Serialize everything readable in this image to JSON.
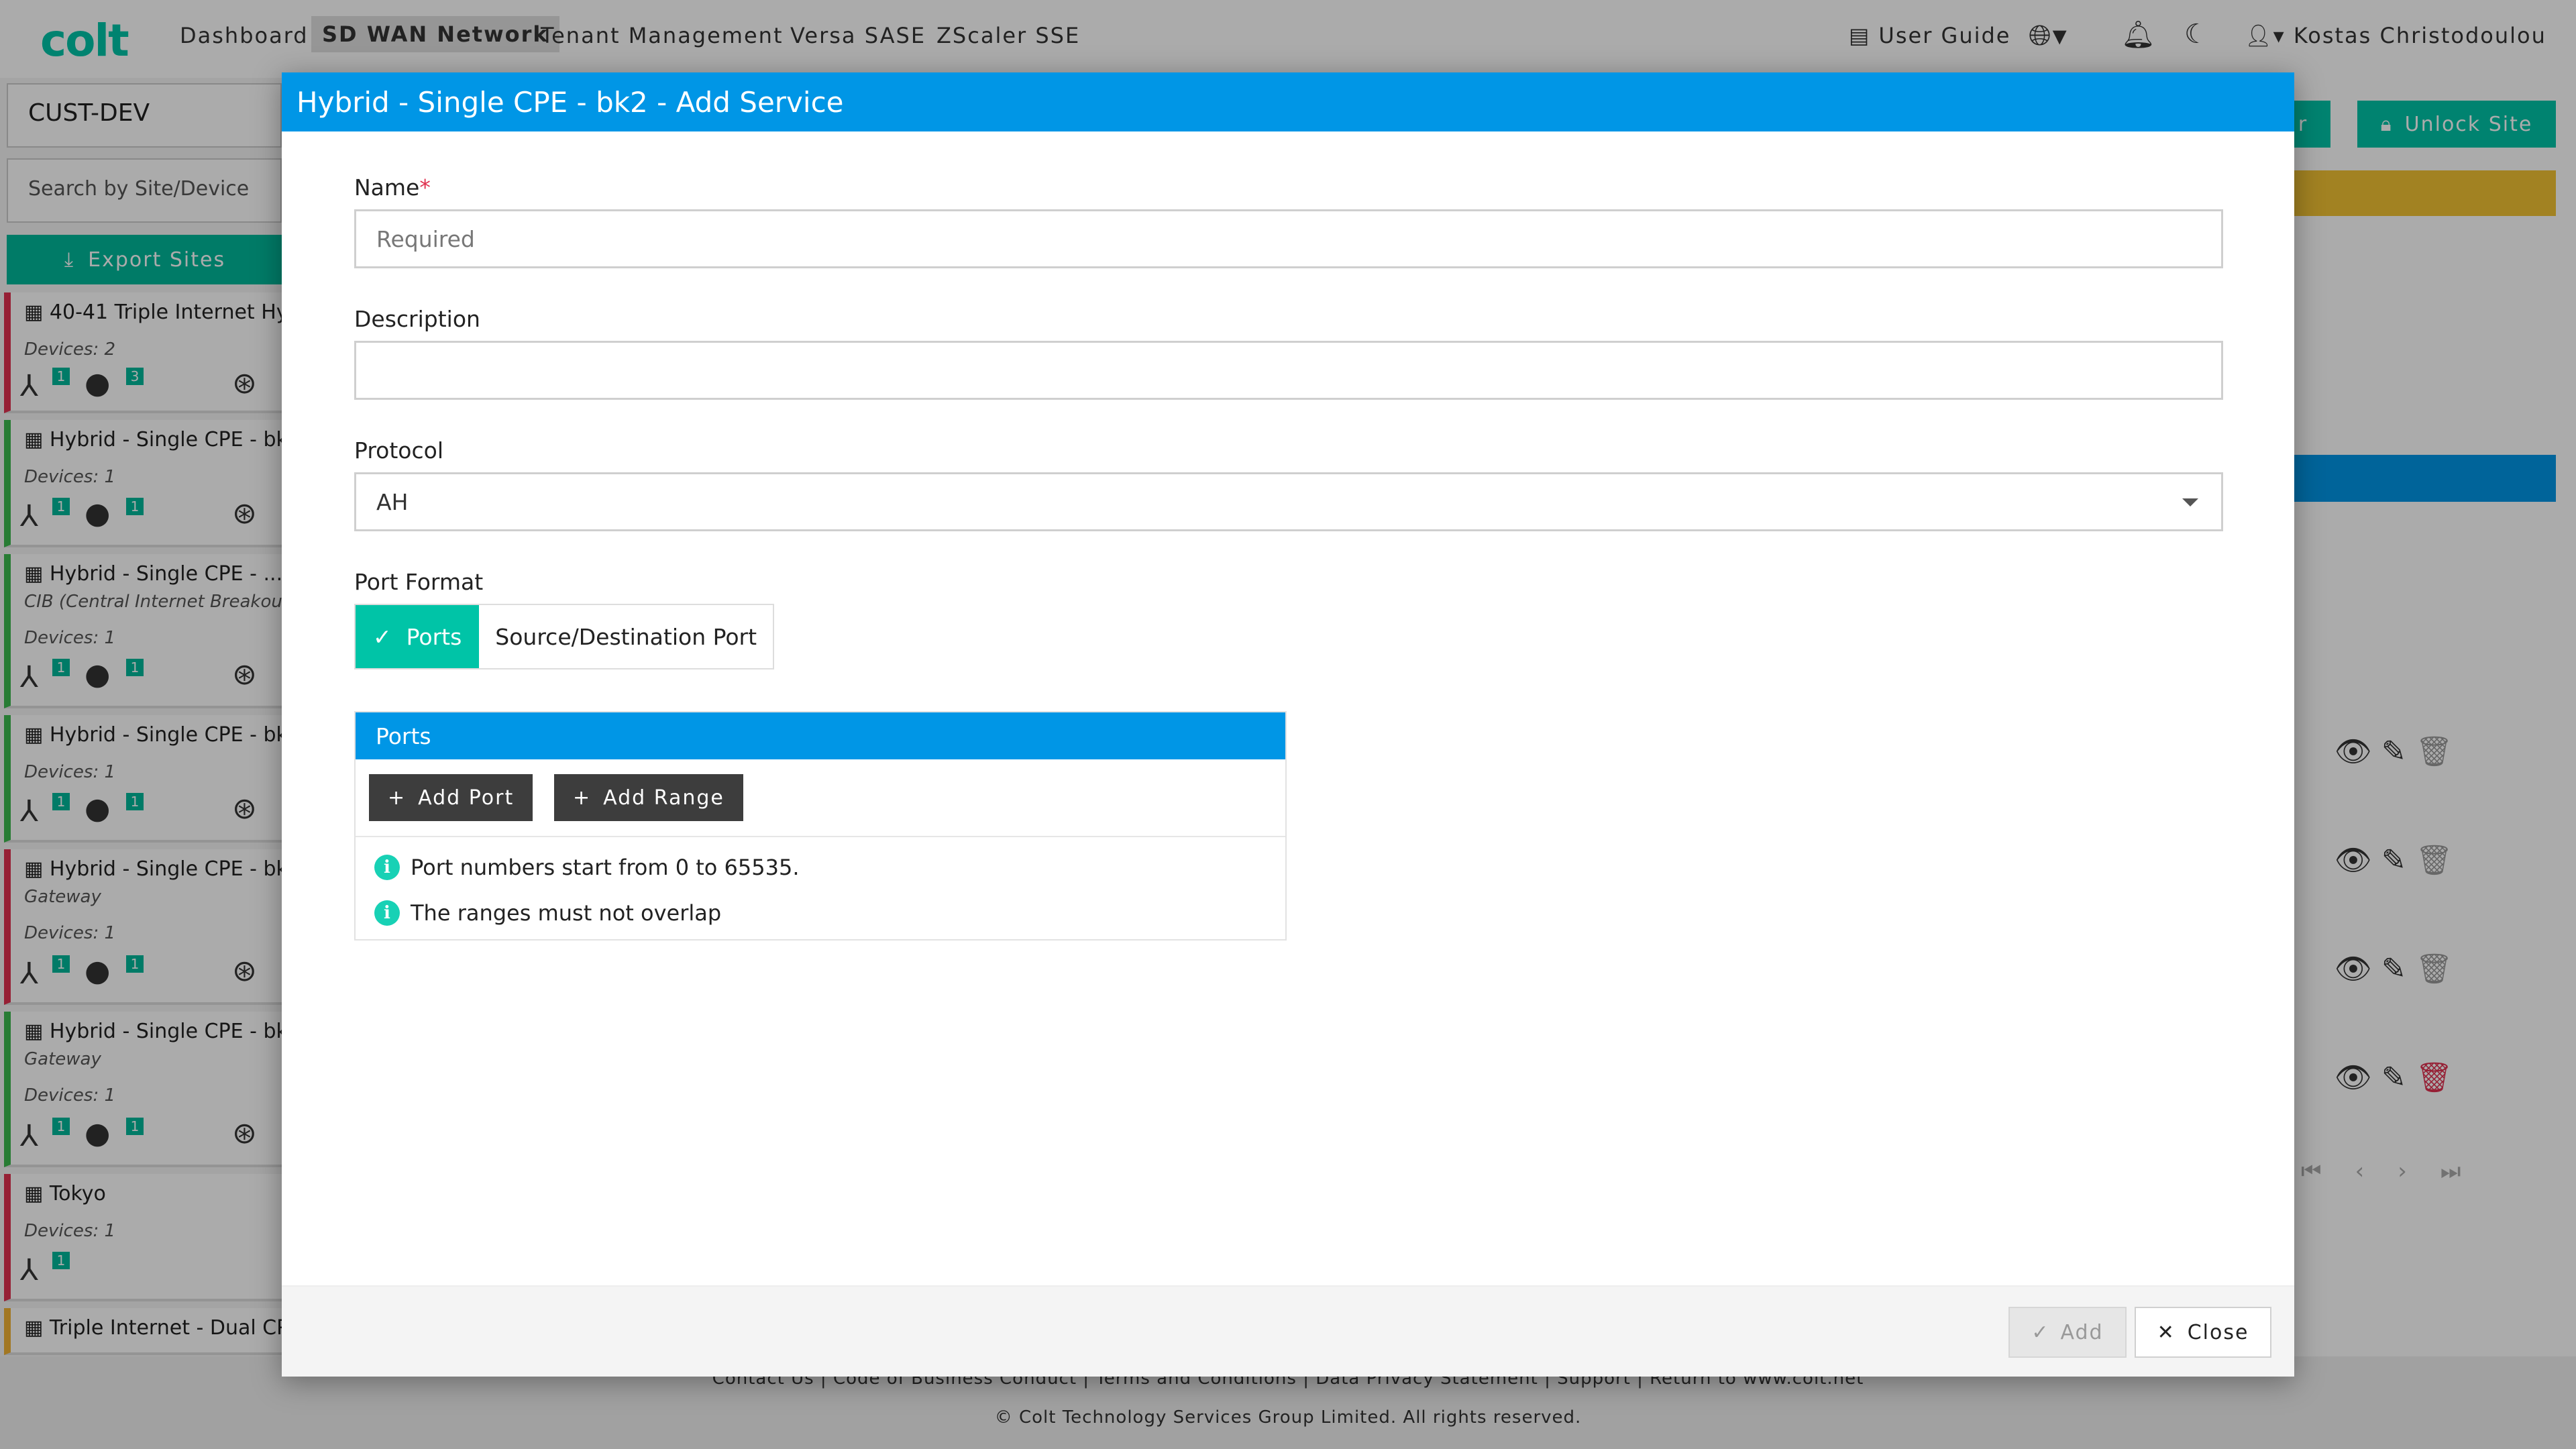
{
  "app": {
    "logo": "colt"
  },
  "nav": {
    "items": [
      "Dashboard",
      "SD WAN Network",
      "Tenant Management",
      "Versa SASE",
      "ZScaler SSE"
    ],
    "active_index": 1,
    "user_guide": "User Guide",
    "user_name": "Kostas Christodoulou"
  },
  "sidebar": {
    "customer": "CUST-DEV",
    "search_placeholder": "Search by Site/Device",
    "export_label": "Export Sites",
    "sites": [
      {
        "title": "40-41 Triple Internet Hy",
        "sub": "",
        "devices": "Devices: 2",
        "badge1": "1",
        "badge2": "3",
        "status": "red"
      },
      {
        "title": "Hybrid - Single CPE - bk",
        "sub": "",
        "devices": "Devices: 1",
        "badge1": "1",
        "badge2": "1",
        "status": "green"
      },
      {
        "title": "Hybrid - Single CPE - ...",
        "sub": "CIB (Central Internet Breakou",
        "devices": "Devices: 1",
        "badge1": "1",
        "badge2": "1",
        "status": "green"
      },
      {
        "title": "Hybrid - Single CPE - bk",
        "sub": "",
        "devices": "Devices: 1",
        "badge1": "1",
        "badge2": "1",
        "status": "green"
      },
      {
        "title": "Hybrid - Single CPE - bk",
        "sub": "Gateway",
        "devices": "Devices: 1",
        "badge1": "1",
        "badge2": "1",
        "status": "red"
      },
      {
        "title": "Hybrid - Single CPE - bk",
        "sub": "Gateway",
        "devices": "Devices: 1",
        "badge1": "1",
        "badge2": "1",
        "status": "green"
      },
      {
        "title": "Tokyo",
        "sub": "",
        "devices": "Devices: 1",
        "badge1": "1",
        "badge2": "",
        "status": "red"
      },
      {
        "title": "Triple Internet - Dual CP",
        "sub": "",
        "devices": "",
        "badge1": "",
        "badge2": "",
        "status": "yellow"
      }
    ]
  },
  "right_panel": {
    "unlock_label": "Unlock Site",
    "partial_button": "r"
  },
  "footer": {
    "links": "Contact Us |  Code of Business Conduct |  Terms and Conditions |  Data Privacy Statement |  Support |  Return to www.colt.net",
    "copyright": "© Colt Technology Services Group Limited. All rights reserved."
  },
  "modal": {
    "title": "Hybrid - Single CPE - bk2 - Add Service",
    "name_label": "Name",
    "name_required_mark": "*",
    "name_placeholder": "Required",
    "description_label": "Description",
    "protocol_label": "Protocol",
    "protocol_value": "AH",
    "port_format_label": "Port Format",
    "port_format_options": [
      "Ports",
      "Source/Destination Port"
    ],
    "port_format_selected": "Ports",
    "ports_panel": {
      "title": "Ports",
      "add_port": "Add Port",
      "add_range": "Add Range",
      "info": [
        "Port numbers start from 0 to 65535.",
        "The ranges must not overlap"
      ]
    },
    "add_button": "Add",
    "close_button": "Close"
  },
  "colors": {
    "brand": "#00c4a7",
    "header_blue": "#0096e6",
    "status_red": "#e0314f",
    "status_green": "#3dba4e",
    "status_yellow": "#f2b233"
  }
}
